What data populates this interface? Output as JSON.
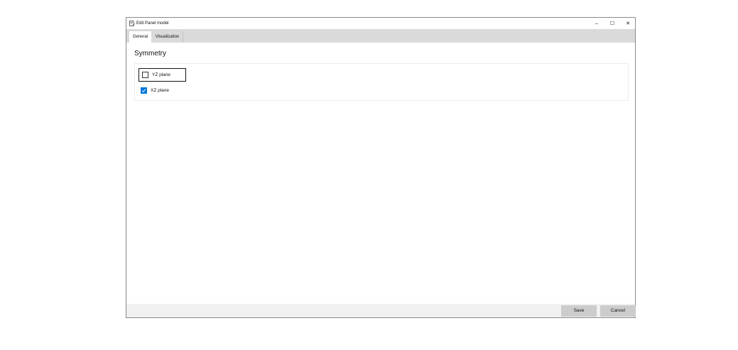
{
  "window": {
    "title": "Edit Panel model",
    "minimize_glyph": "–",
    "maximize_glyph": "☐",
    "close_glyph": "✕"
  },
  "tabs": [
    {
      "label": "General",
      "active": true
    },
    {
      "label": "Visualization",
      "active": false
    }
  ],
  "main": {
    "section_title": "Symmetry",
    "checkboxes": [
      {
        "label": "YZ plane",
        "checked": false,
        "focused": true
      },
      {
        "label": "XZ plane",
        "checked": true,
        "focused": false
      }
    ]
  },
  "footer": {
    "save_label": "Save",
    "cancel_label": "Cancel"
  },
  "colors": {
    "accent": "#0078d7",
    "tab_strip": "#dadada",
    "button": "#cccccc"
  }
}
